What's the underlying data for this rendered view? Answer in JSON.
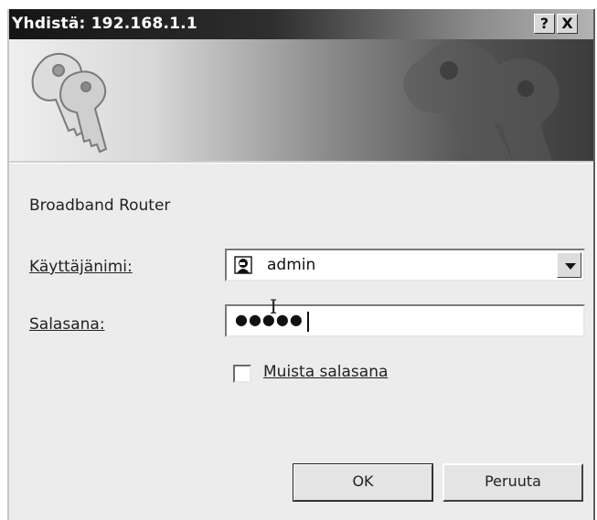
{
  "window": {
    "title": "Yhdistä: 192.168.1.1",
    "help_button": "?",
    "close_button": "X"
  },
  "banner": {
    "icon": "keys-icon",
    "watermark": "keys-watermark-icon"
  },
  "form": {
    "server_text": "Broadband Router",
    "username_label": "Käyttäjänimi:",
    "username_value": "admin",
    "username_icon": "user-icon",
    "password_label": "Salasana:",
    "password_value": "●●●●●",
    "remember_label": "Muista salasana",
    "remember_checked": false
  },
  "buttons": {
    "ok": "OK",
    "cancel": "Peruuta"
  }
}
